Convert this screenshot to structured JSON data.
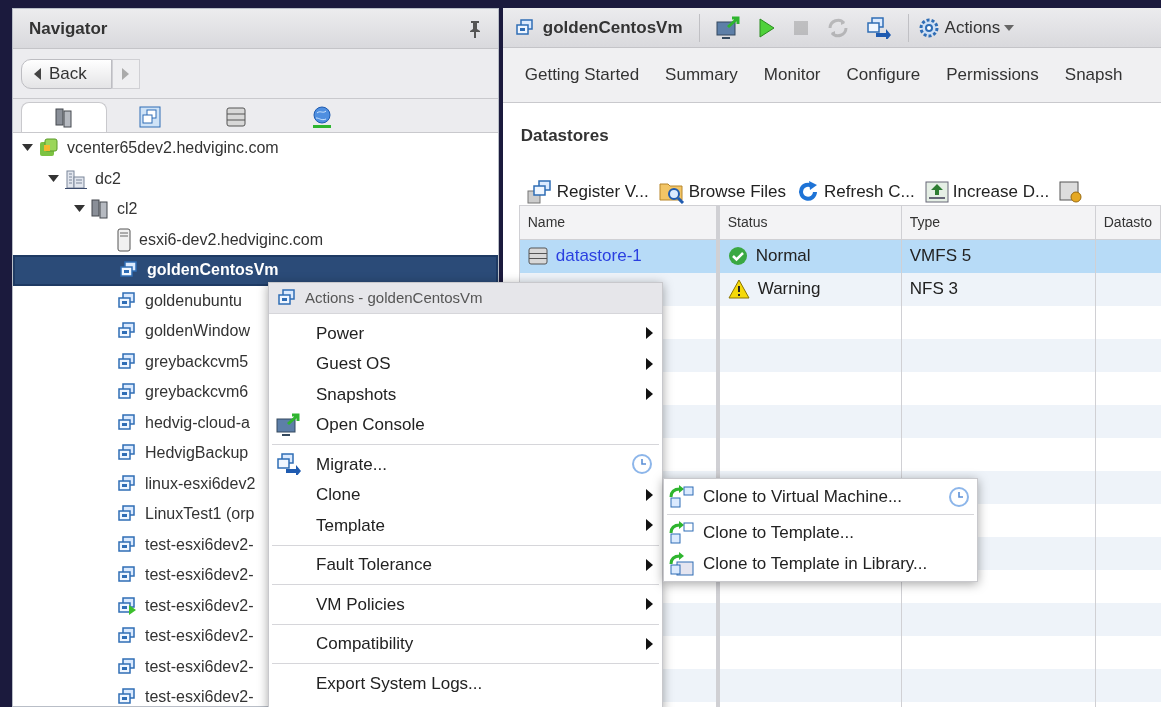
{
  "navigator": {
    "title": "Navigator",
    "back_button": "Back",
    "tabs": [
      {
        "kind": "hosts",
        "selected": true
      },
      {
        "kind": "vms",
        "selected": false
      },
      {
        "kind": "storage",
        "selected": false
      },
      {
        "kind": "network",
        "selected": false
      }
    ],
    "tree": [
      {
        "label": "vcenter65dev2.hedviginc.com",
        "kind": "vcenter",
        "expanded": true,
        "selected": false,
        "children": [
          {
            "label": "dc2",
            "kind": "datacenter",
            "expanded": true,
            "selected": false,
            "children": [
              {
                "label": "cl2",
                "kind": "cluster",
                "expanded": true,
                "selected": false,
                "children": [
                  {
                    "label": "esxi6-dev2.hedviginc.com",
                    "kind": "host",
                    "selected": false
                  },
                  {
                    "label": "goldenCentosVm",
                    "kind": "vm",
                    "selected": true
                  },
                  {
                    "label": "goldenubuntu",
                    "kind": "vm",
                    "selected": false
                  },
                  {
                    "label": "goldenWindow",
                    "kind": "vm",
                    "selected": false
                  },
                  {
                    "label": "greybackcvm5",
                    "kind": "vm",
                    "selected": false
                  },
                  {
                    "label": "greybackcvm6",
                    "kind": "vm",
                    "selected": false
                  },
                  {
                    "label": "hedvig-cloud-a",
                    "kind": "vm",
                    "selected": false
                  },
                  {
                    "label": "HedvigBackup",
                    "kind": "vm",
                    "selected": false
                  },
                  {
                    "label": "linux-esxi6dev2",
                    "kind": "vm",
                    "selected": false
                  },
                  {
                    "label": "LinuxTest1 (orp",
                    "kind": "vm",
                    "selected": false
                  },
                  {
                    "label": "test-esxi6dev2-",
                    "kind": "vm",
                    "selected": false
                  },
                  {
                    "label": "test-esxi6dev2-",
                    "kind": "vm",
                    "selected": false
                  },
                  {
                    "label": "test-esxi6dev2-",
                    "kind": "vm-running",
                    "selected": false
                  },
                  {
                    "label": "test-esxi6dev2-",
                    "kind": "vm",
                    "selected": false
                  },
                  {
                    "label": "test-esxi6dev2-",
                    "kind": "vm",
                    "selected": false
                  },
                  {
                    "label": "test-esxi6dev2-",
                    "kind": "vm",
                    "selected": false
                  }
                ]
              }
            ]
          }
        ]
      }
    ]
  },
  "object_header": {
    "title": "goldenCentosVm",
    "toolbar": [
      {
        "kind": "console",
        "disabled": false
      },
      {
        "kind": "power-on",
        "disabled": false
      },
      {
        "kind": "stop",
        "disabled": true
      },
      {
        "kind": "reset",
        "disabled": true
      },
      {
        "kind": "migrate",
        "disabled": false
      }
    ],
    "actions_button": "Actions"
  },
  "tabs": [
    "Getting Started",
    "Summary",
    "Monitor",
    "Configure",
    "Permissions",
    "Snapsh"
  ],
  "section_title": "Datastores",
  "datastore_toolbar": [
    {
      "kind": "register",
      "label": "Register V..."
    },
    {
      "kind": "browse",
      "label": "Browse Files"
    },
    {
      "kind": "refresh",
      "label": "Refresh C..."
    },
    {
      "kind": "increase",
      "label": "Increase D..."
    },
    {
      "kind": "settings"
    }
  ],
  "table": {
    "columns": [
      "Name",
      "Status",
      "Type",
      "Datasto"
    ],
    "rows": [
      {
        "name": "datastore-1",
        "status": "Normal",
        "kind": "normal",
        "type": "VMFS 5",
        "selected": true
      },
      {
        "status": "Warning",
        "kind": "warning",
        "type": "NFS 3",
        "selected": false
      }
    ]
  },
  "context_menu": {
    "title": "Actions - goldenCentosVm",
    "sections": [
      [
        {
          "label": "Power",
          "kind": "plain",
          "submenu": true,
          "scheduled": false
        },
        {
          "label": "Guest OS",
          "kind": "plain",
          "submenu": true,
          "scheduled": false
        },
        {
          "label": "Snapshots",
          "kind": "plain",
          "submenu": true,
          "scheduled": false
        },
        {
          "label": "Open Console",
          "kind": "console",
          "submenu": false,
          "scheduled": false
        }
      ],
      [
        {
          "label": "Migrate...",
          "kind": "migrate",
          "submenu": false,
          "scheduled": true
        },
        {
          "label": "Clone",
          "kind": "plain",
          "submenu": true,
          "scheduled": false
        },
        {
          "label": "Template",
          "kind": "plain",
          "submenu": true,
          "scheduled": false
        }
      ],
      [
        {
          "label": "Fault Tolerance",
          "kind": "plain",
          "submenu": true,
          "scheduled": false
        }
      ],
      [
        {
          "label": "VM Policies",
          "kind": "plain",
          "submenu": true,
          "scheduled": false
        }
      ],
      [
        {
          "label": "Compatibility",
          "kind": "plain",
          "submenu": true,
          "scheduled": false
        }
      ],
      [
        {
          "label": "Export System Logs...",
          "kind": "plain",
          "submenu": false,
          "scheduled": false
        }
      ]
    ]
  },
  "submenu": {
    "sections": [
      [
        {
          "label": "Clone to Virtual Machine...",
          "kind": "clone-vm",
          "scheduled": true
        }
      ],
      [
        {
          "label": "Clone to Template...",
          "kind": "clone-template",
          "scheduled": false
        },
        {
          "label": "Clone to Template in Library...",
          "kind": "clone-library",
          "scheduled": false
        }
      ]
    ]
  }
}
